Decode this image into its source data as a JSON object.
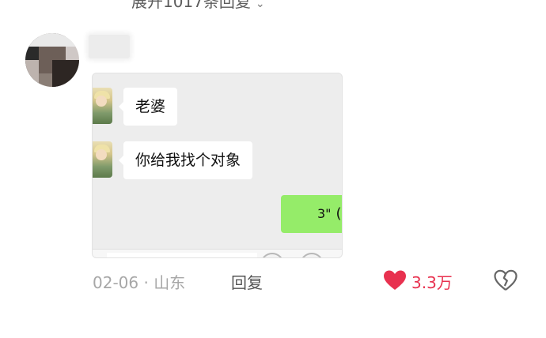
{
  "header": {
    "expand_replies_text": "展开1017条回复",
    "expand_icon": "chevron-down-icon"
  },
  "comment": {
    "avatar": "blurred-avatar",
    "username": "",
    "screenshot": {
      "messages": [
        {
          "side": "left",
          "text": "老婆"
        },
        {
          "side": "left",
          "text": "你给我找个对象"
        },
        {
          "side": "right",
          "text": "3\"",
          "type": "voice",
          "suffix": "("
        }
      ]
    },
    "date": "02-06",
    "separator": "·",
    "location": "山东",
    "reply_label": "回复",
    "like_count": "3.3万",
    "like_icon": "heart-filled-icon",
    "dislike_icon": "broken-heart-icon",
    "colors": {
      "like": "#e8314f",
      "voice_bubble": "#95ec69",
      "meta": "#a7a7a7"
    }
  }
}
